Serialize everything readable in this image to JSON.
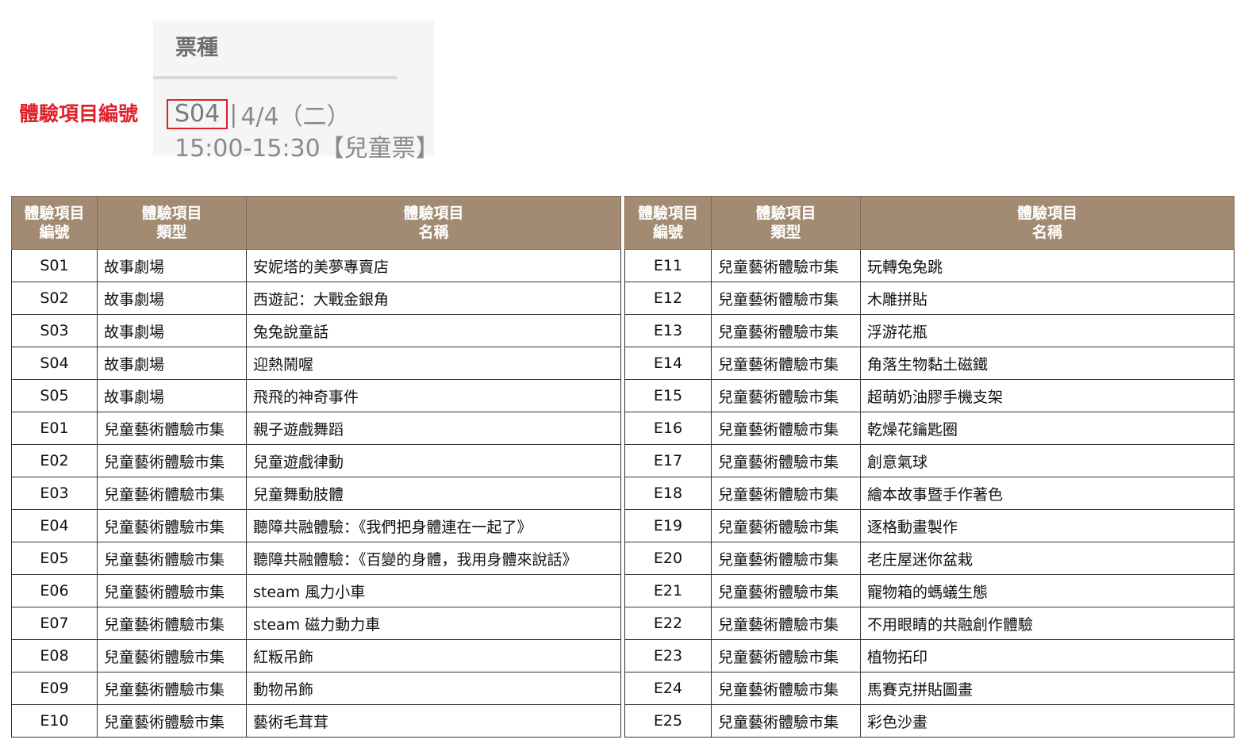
{
  "ticket": {
    "title": "票種",
    "code": "S04",
    "separator": "|",
    "date": "4/4（二）",
    "time_ticket": "15:00-15:30【兒童票】"
  },
  "callout": {
    "label": "體驗項目編號"
  },
  "table_headers": [
    {
      "line1": "體驗項目",
      "line2": "編號"
    },
    {
      "line1": "體驗項目",
      "line2": "類型"
    },
    {
      "line1": "體驗項目",
      "line2": "名稱"
    }
  ],
  "left_rows": [
    {
      "code": "S01",
      "type": "故事劇場",
      "name": "安妮塔的美夢專賣店"
    },
    {
      "code": "S02",
      "type": "故事劇場",
      "name": "西遊記：大戰金銀角"
    },
    {
      "code": "S03",
      "type": "故事劇場",
      "name": "兔兔說童話"
    },
    {
      "code": "S04",
      "type": "故事劇場",
      "name": "迎熱鬧喔"
    },
    {
      "code": "S05",
      "type": "故事劇場",
      "name": "飛飛的神奇事件"
    },
    {
      "code": "E01",
      "type": "兒童藝術體驗市集",
      "name": "親子遊戲舞蹈"
    },
    {
      "code": "E02",
      "type": "兒童藝術體驗市集",
      "name": "兒童遊戲律動"
    },
    {
      "code": "E03",
      "type": "兒童藝術體驗市集",
      "name": "兒童舞動肢體"
    },
    {
      "code": "E04",
      "type": "兒童藝術體驗市集",
      "name": "聽障共融體驗：《我們把身體連在一起了》"
    },
    {
      "code": "E05",
      "type": "兒童藝術體驗市集",
      "name": "聽障共融體驗：《百變的身體，我用身體來說話》"
    },
    {
      "code": "E06",
      "type": "兒童藝術體驗市集",
      "name": "steam 風力小車"
    },
    {
      "code": "E07",
      "type": "兒童藝術體驗市集",
      "name": "steam 磁力動力車"
    },
    {
      "code": "E08",
      "type": "兒童藝術體驗市集",
      "name": "紅粄吊飾"
    },
    {
      "code": "E09",
      "type": "兒童藝術體驗市集",
      "name": "動物吊飾"
    },
    {
      "code": "E10",
      "type": "兒童藝術體驗市集",
      "name": "藝術毛茸茸"
    }
  ],
  "right_rows": [
    {
      "code": "E11",
      "type": "兒童藝術體驗市集",
      "name": "玩轉兔兔跳"
    },
    {
      "code": "E12",
      "type": "兒童藝術體驗市集",
      "name": "木雕拼貼"
    },
    {
      "code": "E13",
      "type": "兒童藝術體驗市集",
      "name": "浮游花瓶"
    },
    {
      "code": "E14",
      "type": "兒童藝術體驗市集",
      "name": "角落生物黏土磁鐵"
    },
    {
      "code": "E15",
      "type": "兒童藝術體驗市集",
      "name": "超萌奶油膠手機支架"
    },
    {
      "code": "E16",
      "type": "兒童藝術體驗市集",
      "name": "乾燥花鑰匙圈"
    },
    {
      "code": "E17",
      "type": "兒童藝術體驗市集",
      "name": "創意氣球"
    },
    {
      "code": "E18",
      "type": "兒童藝術體驗市集",
      "name": "繪本故事暨手作著色"
    },
    {
      "code": "E19",
      "type": "兒童藝術體驗市集",
      "name": "逐格動畫製作"
    },
    {
      "code": "E20",
      "type": "兒童藝術體驗市集",
      "name": "老庄屋迷你盆栽"
    },
    {
      "code": "E21",
      "type": "兒童藝術體驗市集",
      "name": "寵物箱的螞蟻生態"
    },
    {
      "code": "E22",
      "type": "兒童藝術體驗市集",
      "name": "不用眼睛的共融創作體驗"
    },
    {
      "code": "E23",
      "type": "兒童藝術體驗市集",
      "name": "植物拓印"
    },
    {
      "code": "E24",
      "type": "兒童藝術體驗市集",
      "name": "馬賽克拼貼圖畫"
    },
    {
      "code": "E25",
      "type": "兒童藝術體驗市集",
      "name": "彩色沙畫"
    }
  ],
  "colors": {
    "header_bg": "#a28b72",
    "highlight_red": "#e0202a",
    "card_bg": "#f5f5f5"
  }
}
